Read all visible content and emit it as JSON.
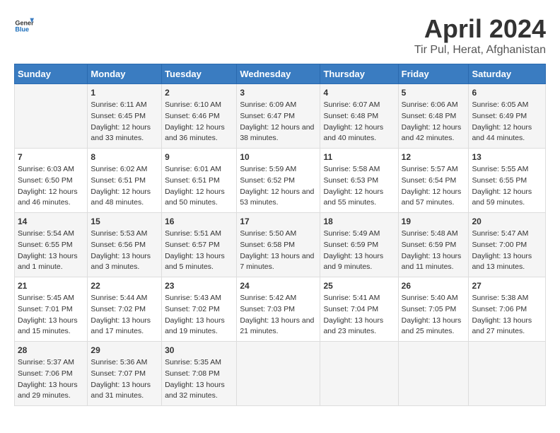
{
  "header": {
    "logo_general": "General",
    "logo_blue": "Blue",
    "main_title": "April 2024",
    "sub_title": "Tir Pul, Herat, Afghanistan"
  },
  "calendar": {
    "weekdays": [
      "Sunday",
      "Monday",
      "Tuesday",
      "Wednesday",
      "Thursday",
      "Friday",
      "Saturday"
    ],
    "weeks": [
      [
        {
          "day": "",
          "info": ""
        },
        {
          "day": "1",
          "sunrise": "Sunrise: 6:11 AM",
          "sunset": "Sunset: 6:45 PM",
          "daylight": "Daylight: 12 hours and 33 minutes."
        },
        {
          "day": "2",
          "sunrise": "Sunrise: 6:10 AM",
          "sunset": "Sunset: 6:46 PM",
          "daylight": "Daylight: 12 hours and 36 minutes."
        },
        {
          "day": "3",
          "sunrise": "Sunrise: 6:09 AM",
          "sunset": "Sunset: 6:47 PM",
          "daylight": "Daylight: 12 hours and 38 minutes."
        },
        {
          "day": "4",
          "sunrise": "Sunrise: 6:07 AM",
          "sunset": "Sunset: 6:48 PM",
          "daylight": "Daylight: 12 hours and 40 minutes."
        },
        {
          "day": "5",
          "sunrise": "Sunrise: 6:06 AM",
          "sunset": "Sunset: 6:48 PM",
          "daylight": "Daylight: 12 hours and 42 minutes."
        },
        {
          "day": "6",
          "sunrise": "Sunrise: 6:05 AM",
          "sunset": "Sunset: 6:49 PM",
          "daylight": "Daylight: 12 hours and 44 minutes."
        }
      ],
      [
        {
          "day": "7",
          "sunrise": "Sunrise: 6:03 AM",
          "sunset": "Sunset: 6:50 PM",
          "daylight": "Daylight: 12 hours and 46 minutes."
        },
        {
          "day": "8",
          "sunrise": "Sunrise: 6:02 AM",
          "sunset": "Sunset: 6:51 PM",
          "daylight": "Daylight: 12 hours and 48 minutes."
        },
        {
          "day": "9",
          "sunrise": "Sunrise: 6:01 AM",
          "sunset": "Sunset: 6:51 PM",
          "daylight": "Daylight: 12 hours and 50 minutes."
        },
        {
          "day": "10",
          "sunrise": "Sunrise: 5:59 AM",
          "sunset": "Sunset: 6:52 PM",
          "daylight": "Daylight: 12 hours and 53 minutes."
        },
        {
          "day": "11",
          "sunrise": "Sunrise: 5:58 AM",
          "sunset": "Sunset: 6:53 PM",
          "daylight": "Daylight: 12 hours and 55 minutes."
        },
        {
          "day": "12",
          "sunrise": "Sunrise: 5:57 AM",
          "sunset": "Sunset: 6:54 PM",
          "daylight": "Daylight: 12 hours and 57 minutes."
        },
        {
          "day": "13",
          "sunrise": "Sunrise: 5:55 AM",
          "sunset": "Sunset: 6:55 PM",
          "daylight": "Daylight: 12 hours and 59 minutes."
        }
      ],
      [
        {
          "day": "14",
          "sunrise": "Sunrise: 5:54 AM",
          "sunset": "Sunset: 6:55 PM",
          "daylight": "Daylight: 13 hours and 1 minute."
        },
        {
          "day": "15",
          "sunrise": "Sunrise: 5:53 AM",
          "sunset": "Sunset: 6:56 PM",
          "daylight": "Daylight: 13 hours and 3 minutes."
        },
        {
          "day": "16",
          "sunrise": "Sunrise: 5:51 AM",
          "sunset": "Sunset: 6:57 PM",
          "daylight": "Daylight: 13 hours and 5 minutes."
        },
        {
          "day": "17",
          "sunrise": "Sunrise: 5:50 AM",
          "sunset": "Sunset: 6:58 PM",
          "daylight": "Daylight: 13 hours and 7 minutes."
        },
        {
          "day": "18",
          "sunrise": "Sunrise: 5:49 AM",
          "sunset": "Sunset: 6:59 PM",
          "daylight": "Daylight: 13 hours and 9 minutes."
        },
        {
          "day": "19",
          "sunrise": "Sunrise: 5:48 AM",
          "sunset": "Sunset: 6:59 PM",
          "daylight": "Daylight: 13 hours and 11 minutes."
        },
        {
          "day": "20",
          "sunrise": "Sunrise: 5:47 AM",
          "sunset": "Sunset: 7:00 PM",
          "daylight": "Daylight: 13 hours and 13 minutes."
        }
      ],
      [
        {
          "day": "21",
          "sunrise": "Sunrise: 5:45 AM",
          "sunset": "Sunset: 7:01 PM",
          "daylight": "Daylight: 13 hours and 15 minutes."
        },
        {
          "day": "22",
          "sunrise": "Sunrise: 5:44 AM",
          "sunset": "Sunset: 7:02 PM",
          "daylight": "Daylight: 13 hours and 17 minutes."
        },
        {
          "day": "23",
          "sunrise": "Sunrise: 5:43 AM",
          "sunset": "Sunset: 7:02 PM",
          "daylight": "Daylight: 13 hours and 19 minutes."
        },
        {
          "day": "24",
          "sunrise": "Sunrise: 5:42 AM",
          "sunset": "Sunset: 7:03 PM",
          "daylight": "Daylight: 13 hours and 21 minutes."
        },
        {
          "day": "25",
          "sunrise": "Sunrise: 5:41 AM",
          "sunset": "Sunset: 7:04 PM",
          "daylight": "Daylight: 13 hours and 23 minutes."
        },
        {
          "day": "26",
          "sunrise": "Sunrise: 5:40 AM",
          "sunset": "Sunset: 7:05 PM",
          "daylight": "Daylight: 13 hours and 25 minutes."
        },
        {
          "day": "27",
          "sunrise": "Sunrise: 5:38 AM",
          "sunset": "Sunset: 7:06 PM",
          "daylight": "Daylight: 13 hours and 27 minutes."
        }
      ],
      [
        {
          "day": "28",
          "sunrise": "Sunrise: 5:37 AM",
          "sunset": "Sunset: 7:06 PM",
          "daylight": "Daylight: 13 hours and 29 minutes."
        },
        {
          "day": "29",
          "sunrise": "Sunrise: 5:36 AM",
          "sunset": "Sunset: 7:07 PM",
          "daylight": "Daylight: 13 hours and 31 minutes."
        },
        {
          "day": "30",
          "sunrise": "Sunrise: 5:35 AM",
          "sunset": "Sunset: 7:08 PM",
          "daylight": "Daylight: 13 hours and 32 minutes."
        },
        {
          "day": "",
          "info": ""
        },
        {
          "day": "",
          "info": ""
        },
        {
          "day": "",
          "info": ""
        },
        {
          "day": "",
          "info": ""
        }
      ]
    ]
  }
}
